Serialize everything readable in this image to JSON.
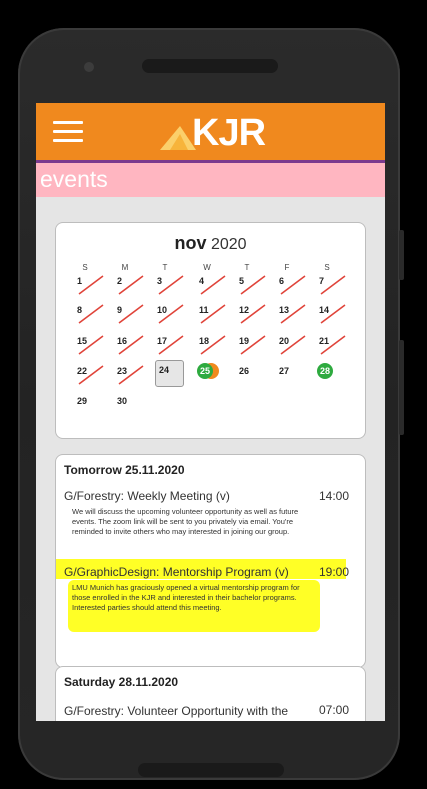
{
  "app": {
    "logo_text": "KJR",
    "page_title": "events"
  },
  "calendar": {
    "month": "nov",
    "year": "2020",
    "weekdays": [
      "S",
      "M",
      "T",
      "W",
      "T",
      "F",
      "S"
    ],
    "weeks": [
      [
        "1",
        "2",
        "3",
        "4",
        "5",
        "6",
        "7"
      ],
      [
        "8",
        "9",
        "10",
        "11",
        "12",
        "13",
        "14"
      ],
      [
        "15",
        "16",
        "17",
        "18",
        "19",
        "20",
        "21"
      ],
      [
        "22",
        "23",
        "24",
        "25",
        "26",
        "27",
        "28"
      ],
      [
        "29",
        "30"
      ]
    ],
    "crossed_out_through": 23,
    "today": "24",
    "event_days": {
      "25": [
        "green",
        "orange"
      ],
      "28": [
        "green"
      ]
    },
    "colors": {
      "cross": "#e0443a",
      "green": "#2eaa3f",
      "orange": "#f0891e"
    }
  },
  "days": [
    {
      "heading": "Tomorrow 25.11.2020",
      "events": [
        {
          "title": "G/Forestry: Weekly Meeting (v)",
          "time": "14:00",
          "description": "We will discuss the upcoming volunteer opportunity as well as future events. The zoom link will be sent to you privately via email. You're reminded to invite others who may interested in joining our group."
        },
        {
          "title": "G/GraphicDesign: Mentorship Program (v)",
          "time": "19:00",
          "description": "LMU Munich has graciously opened a virtual mentorship program for those enrolled in the KJR and interested in their bachelor programs. Interested parties should attend this meeting."
        }
      ]
    },
    {
      "heading": "Saturday 28.11.2020",
      "events": [
        {
          "title": "G/Forestry: Volunteer Opportunity with the Bavarian State Institute for Forest and",
          "time": "07:00"
        }
      ]
    }
  ],
  "colors": {
    "header": "#f0891e",
    "header_border": "#7b3a8e",
    "page_bar": "#ffb6c1",
    "highlight": "#ffff00"
  }
}
